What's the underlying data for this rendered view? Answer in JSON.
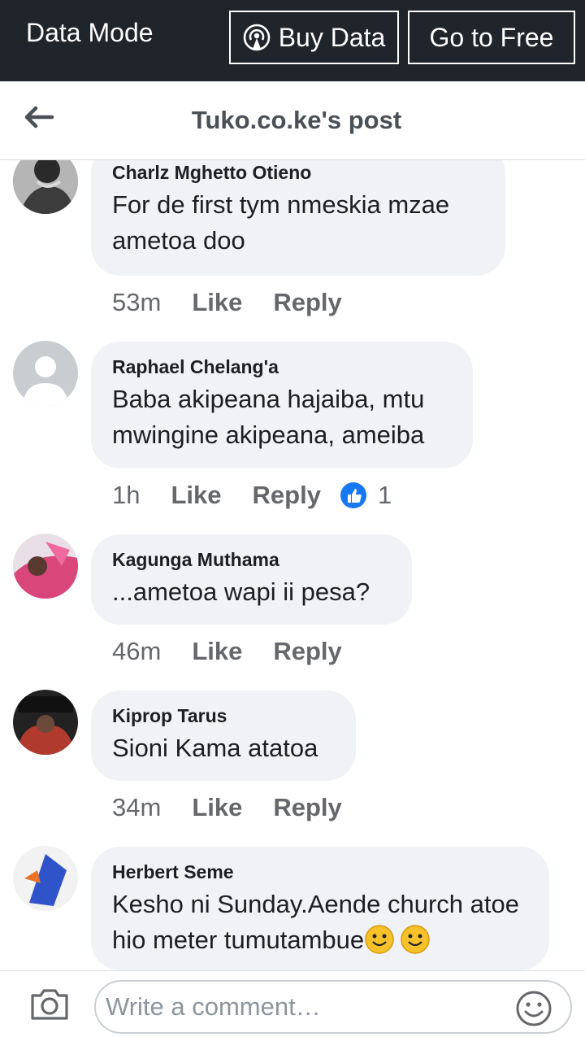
{
  "topbar": {
    "mode": "Data Mode",
    "buy": "Buy Data",
    "free": "Go to Free"
  },
  "header": {
    "title": "Tuko.co.ke's post"
  },
  "comments": [
    {
      "author": "Charlz Mghetto Otieno",
      "text": "For de first tym nmeskia mzae ametoa doo",
      "time": "53m",
      "like": "Like",
      "reply": "Reply"
    },
    {
      "author": "Raphael Chelang'a",
      "text": "Baba akipeana hajaiba, mtu mwingine akipeana, ameiba",
      "time": "1h",
      "like": "Like",
      "reply": "Reply",
      "reactions": "1"
    },
    {
      "author": "Kagunga Muthama",
      "text": "...ametoa wapi ii pesa?",
      "time": "46m",
      "like": "Like",
      "reply": "Reply"
    },
    {
      "author": "Kiprop Tarus",
      "text": "Sioni Kama atatoa",
      "time": "34m",
      "like": "Like",
      "reply": "Reply"
    },
    {
      "author": "Herbert Seme",
      "text": "Kesho ni Sunday.Aende church atoe hio meter tumutambue",
      "time": "",
      "like": "",
      "reply": ""
    }
  ],
  "composer": {
    "placeholder": "Write a comment…"
  },
  "icons": {
    "back": "back-arrow-icon",
    "broadcast": "broadcast-icon",
    "camera": "camera-icon",
    "emoji": "emoji-icon",
    "like_reaction": "like-reaction-icon"
  },
  "colors": {
    "topbar": "#20242b",
    "bubble": "#f0f2f5",
    "like_blue": "#1877f2",
    "meta": "#65676b"
  }
}
